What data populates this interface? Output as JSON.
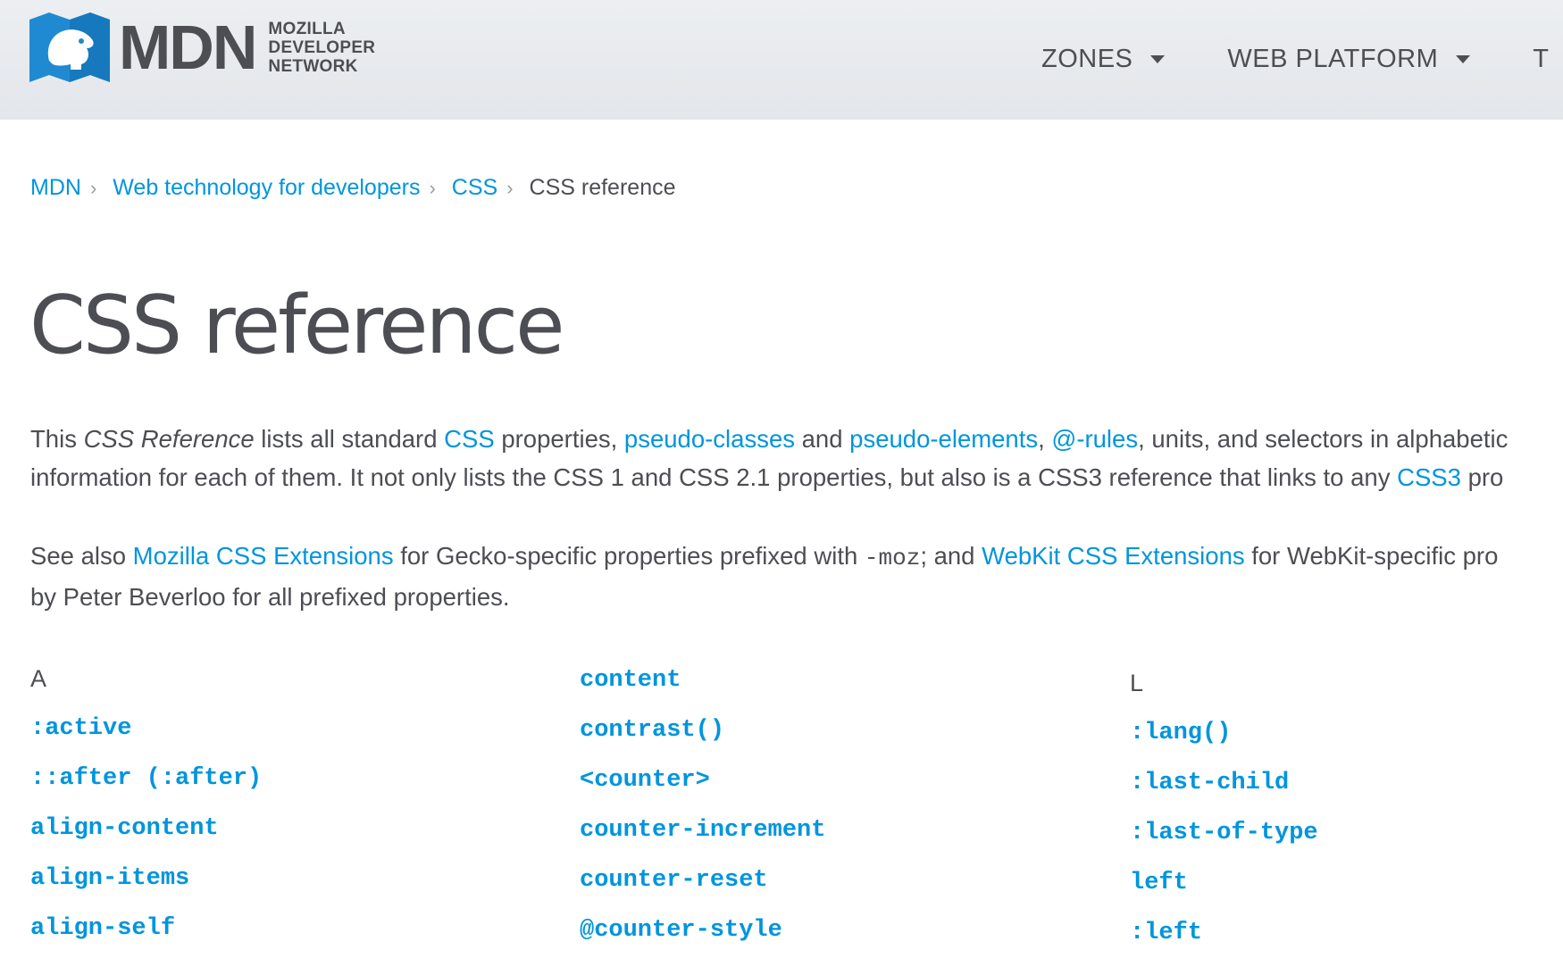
{
  "header": {
    "logo_text": "MDN",
    "logo_sub": [
      "MOZILLA",
      "DEVELOPER",
      "NETWORK"
    ],
    "nav": [
      {
        "label": "ZONES"
      },
      {
        "label": "WEB PLATFORM"
      },
      {
        "label": "T"
      }
    ]
  },
  "breadcrumb": {
    "items": [
      "MDN",
      "Web technology for developers",
      "CSS"
    ],
    "current": "CSS reference"
  },
  "page_title": "CSS reference",
  "intro": {
    "p1": {
      "t0": "This ",
      "em": "CSS Reference",
      "t1": " lists all standard ",
      "link_css": "CSS",
      "t2": " properties, ",
      "link_pseudo_classes": "pseudo-classes",
      "t3": " and ",
      "link_pseudo_elements": "pseudo-elements",
      "t4": ", ",
      "link_at_rules": "@-rules",
      "t5": ", units, and selectors in alphabetic",
      "line2_t0": "information for each of them. It not only lists the CSS 1 and CSS 2.1 properties, but also is a CSS3 reference that links to any ",
      "link_css3": "CSS3",
      "line2_t1": " pro"
    },
    "p2": {
      "t0": "See also ",
      "link_moz": "Mozilla CSS Extensions",
      "t1": " for Gecko-specific properties prefixed with ",
      "code": "-moz",
      "t2": "; and ",
      "link_webkit": "WebKit CSS Extensions",
      "t3": " for WebKit-specific pro",
      "line2": "by Peter Beverloo for all prefixed properties."
    }
  },
  "columns": [
    {
      "letter": "A",
      "items": [
        ":active",
        "::after (:after)",
        "align-content",
        "align-items",
        "align-self"
      ]
    },
    {
      "letter": "",
      "items": [
        "content",
        "contrast()",
        "<counter>",
        "counter-increment",
        "counter-reset",
        "@counter-style"
      ]
    },
    {
      "letter": "L",
      "items": [
        ":lang()",
        ":last-child",
        ":last-of-type",
        "left",
        ":left"
      ]
    }
  ],
  "colors": {
    "link": "#0095dd",
    "text": "#4d4e53",
    "header_bg": "#e7eaed",
    "logo_blue": "#1f8ad1"
  },
  "icons": {
    "logo": "mdn-dino-logo-icon",
    "caret": "caret-down-icon",
    "crumb_sep": "chevron-right-icon"
  }
}
